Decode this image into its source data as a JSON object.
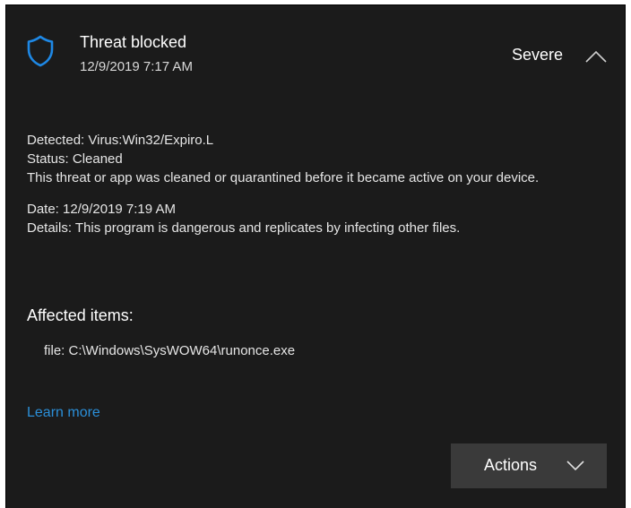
{
  "header": {
    "title": "Threat blocked",
    "timestamp": "12/9/2019 7:17 AM",
    "severity": "Severe",
    "shield_icon": "shield-icon",
    "collapse_icon": "chevron-up-icon"
  },
  "details": {
    "detected": "Detected:  Virus:Win32/Expiro.L",
    "status": "Status:  Cleaned",
    "message": "This threat or app was cleaned or quarantined before it became active on your device.",
    "date": "Date:  12/9/2019 7:19 AM",
    "description": "Details:  This program is dangerous and replicates by infecting other files."
  },
  "affected": {
    "title": "Affected items:",
    "items": [
      "file: C:\\Windows\\SysWOW64\\runonce.exe"
    ]
  },
  "links": {
    "learn_more": "Learn more"
  },
  "actions": {
    "label": "Actions",
    "icon": "chevron-down-icon"
  },
  "colors": {
    "panel_bg": "#1b1b1b",
    "accent_blue": "#2b8fd8",
    "button_bg": "#3a3a3a"
  }
}
